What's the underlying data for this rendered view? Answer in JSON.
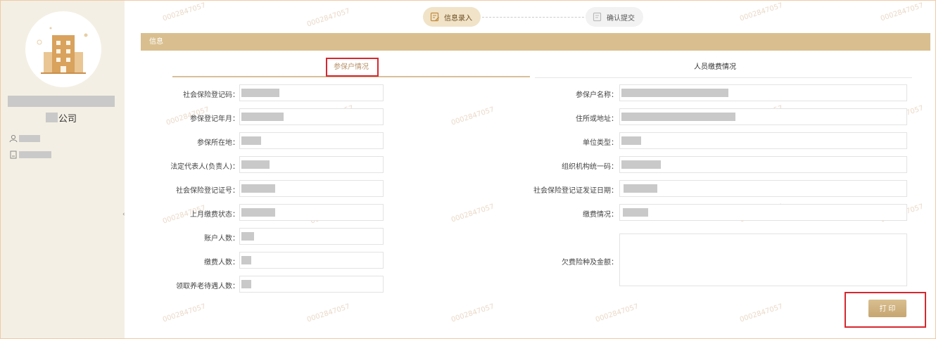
{
  "sidebar": {
    "company_suffix": "公司",
    "toggle_glyph": "‹"
  },
  "steps": [
    {
      "label": "信息录入",
      "state": "active"
    },
    {
      "label": "确认提交",
      "state": "inactive"
    }
  ],
  "panel": {
    "title": "信息"
  },
  "tabs": [
    {
      "label": "参保户情况",
      "active": true
    },
    {
      "label": "人员缴费情况",
      "active": false
    }
  ],
  "form": {
    "left": [
      {
        "label": "社会保险登记码："
      },
      {
        "label": "参保登记年月："
      },
      {
        "label": "参保所在地："
      },
      {
        "label": "法定代表人(负责人)："
      },
      {
        "label": "社会保险登记证号："
      },
      {
        "label": "上月缴费状态："
      },
      {
        "label": "账户人数："
      },
      {
        "label": "缴费人数："
      },
      {
        "label": "领取养老待遇人数："
      }
    ],
    "right": [
      {
        "label": "参保户名称："
      },
      {
        "label": "住所或地址："
      },
      {
        "label": "单位类型："
      },
      {
        "label": "组织机构统一码："
      },
      {
        "label": "社会保险登记证发证日期："
      },
      {
        "label": "缴费情况："
      },
      {
        "label": "欠费险种及金额："
      }
    ]
  },
  "actions": {
    "print_label": "打 印"
  },
  "watermark": "0002847057",
  "colors": {
    "accent": "#d9bf8f",
    "highlight": "#d6282f",
    "sidebar_bg": "#f4efe4"
  }
}
